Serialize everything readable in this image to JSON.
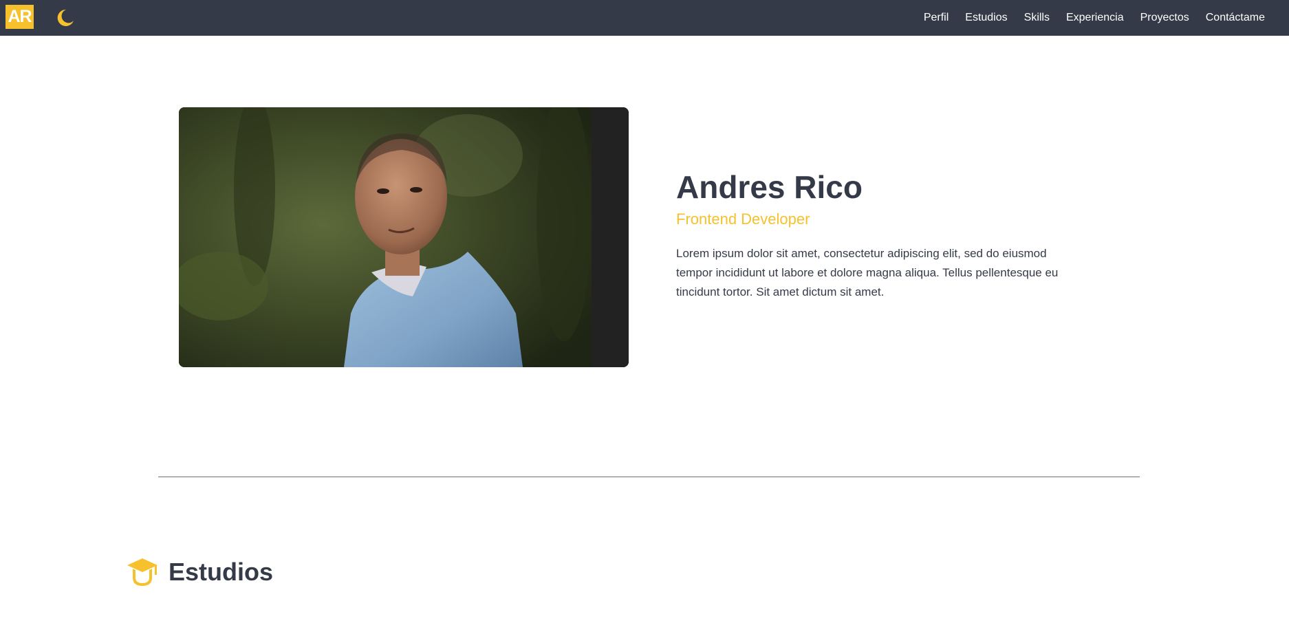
{
  "brand": {
    "logo_text": "AR",
    "accent_color": "#f6c12d",
    "nav_bg": "#343a48"
  },
  "theme_toggle": {
    "icon": "moon-icon"
  },
  "nav": {
    "items": [
      {
        "label": "Perfil"
      },
      {
        "label": "Estudios"
      },
      {
        "label": "Skills"
      },
      {
        "label": "Experiencia"
      },
      {
        "label": "Proyectos"
      },
      {
        "label": "Contáctame"
      }
    ]
  },
  "hero": {
    "name": "Andres Rico",
    "role": "Frontend Developer",
    "description": "Lorem ipsum dolor sit amet, consectetur adipiscing elit, sed do eiusmod tempor incididunt ut labore et dolore magna aliqua. Tellus pellentesque eu tincidunt tortor. Sit amet dictum sit amet."
  },
  "studies_section": {
    "title": "Estudios",
    "icon": "graduation-cap-icon"
  }
}
